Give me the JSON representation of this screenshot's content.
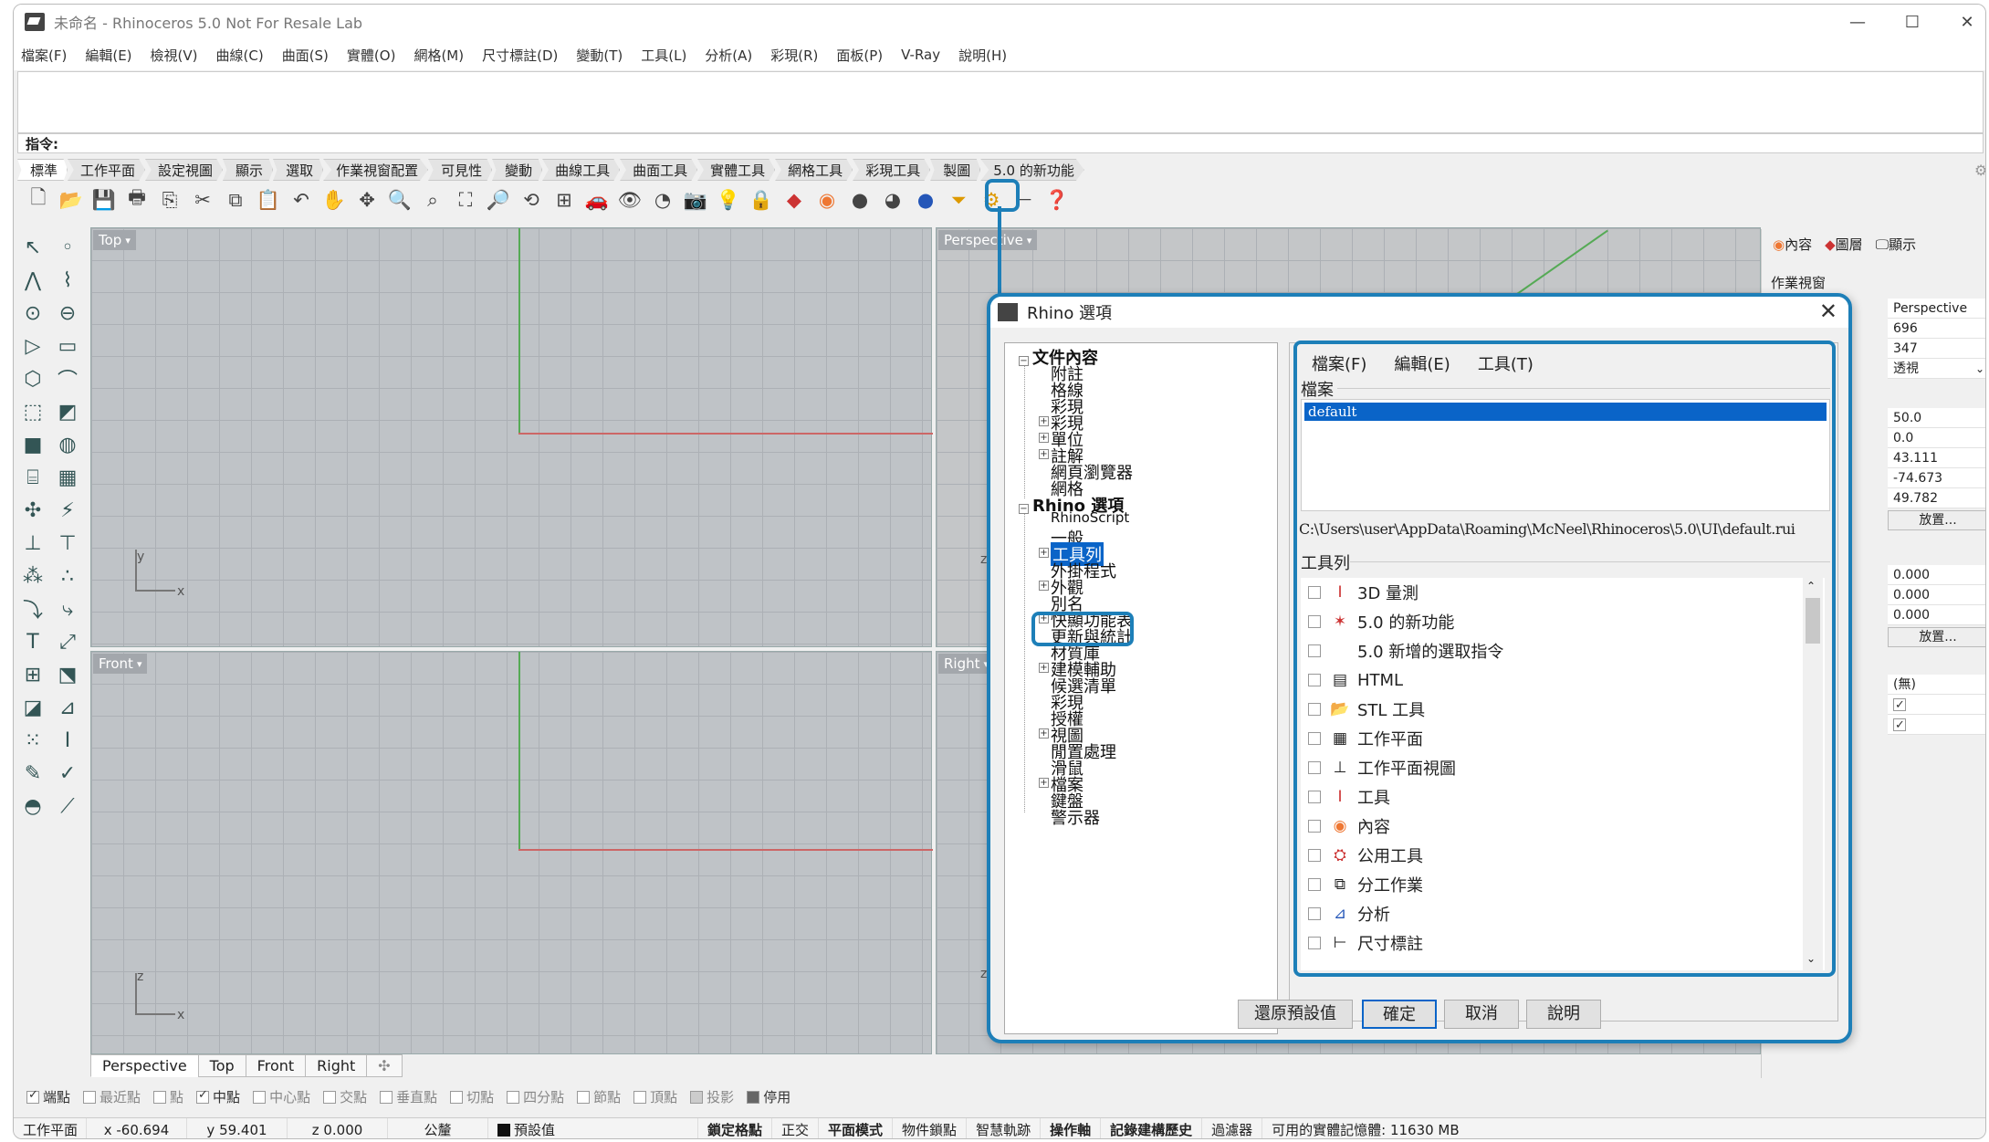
{
  "app": {
    "title": "未命名 - Rhinoceros 5.0 Not For Resale Lab"
  },
  "menu": [
    "檔案(F)",
    "編輯(E)",
    "檢視(V)",
    "曲線(C)",
    "曲面(S)",
    "實體(O)",
    "網格(M)",
    "尺寸標註(D)",
    "變動(T)",
    "工具(L)",
    "分析(A)",
    "彩現(R)",
    "面板(P)",
    "V-Ray",
    "說明(H)"
  ],
  "command": {
    "prompt": "指令:"
  },
  "tabs": [
    "標準",
    "工作平面",
    "設定視圖",
    "顯示",
    "選取",
    "作業視窗配置",
    "可見性",
    "變動",
    "曲線工具",
    "曲面工具",
    "實體工具",
    "網格工具",
    "彩現工具",
    "製圖",
    "5.0 的新功能"
  ],
  "toolbar_icons": [
    "new-icon",
    "open-icon",
    "save-icon",
    "print-icon",
    "export-icon",
    "cut-icon",
    "copy-icon",
    "paste-icon",
    "undo-icon",
    "pan-icon",
    "move-icon",
    "zoom-icon",
    "zoom-window-icon",
    "zoom-extents-icon",
    "zoom-selected-icon",
    "rotate-view-icon",
    "viewport-layout-icon",
    "car-icon",
    "hide-icon",
    "show-icon",
    "snapshot-icon",
    "light-icon",
    "lock-icon",
    "layer-icon",
    "color-wheel-icon",
    "sphere-icon",
    "render-icon",
    "blue-sphere-icon",
    "filter-icon",
    "gear-icon",
    "dimension-icon",
    "help-icon"
  ],
  "viewports": {
    "top": "Top",
    "perspective": "Perspective",
    "front": "Front",
    "right": "Right"
  },
  "axes": {
    "x": "x",
    "y": "y",
    "z": "z"
  },
  "viewport_tabs": [
    "Perspective",
    "Top",
    "Front",
    "Right"
  ],
  "osnap": [
    {
      "label": "端點",
      "on": true
    },
    {
      "label": "最近點",
      "on": false
    },
    {
      "label": "點",
      "on": false
    },
    {
      "label": "中點",
      "on": true
    },
    {
      "label": "中心點",
      "on": false
    },
    {
      "label": "交點",
      "on": false
    },
    {
      "label": "垂直點",
      "on": false
    },
    {
      "label": "切點",
      "on": false
    },
    {
      "label": "四分點",
      "on": false
    },
    {
      "label": "節點",
      "on": false
    },
    {
      "label": "頂點",
      "on": false
    },
    {
      "label": "投影",
      "on": false
    },
    {
      "label": "停用",
      "on": true
    }
  ],
  "status": {
    "plane": "工作平面",
    "x": "x -60.694",
    "y": "y 59.401",
    "z": "z 0.000",
    "unit": "公釐",
    "layer": "預設值",
    "grid": "鎖定格點",
    "ortho": "正交",
    "planar": "平面模式",
    "osnap": "物件鎖點",
    "smarttrack": "智慧軌跡",
    "gumball": "操作軸",
    "history": "記錄建構歷史",
    "filter": "過濾器",
    "memory": "可用的實體記憶體: 11630 MB"
  },
  "props": {
    "tabs": [
      "內容",
      "圖層",
      "顯示"
    ],
    "section": "作業視窗",
    "values": [
      "Perspective",
      "696",
      "347",
      "透視",
      "50.0",
      "0.0",
      "43.111",
      "-74.673",
      "49.782"
    ],
    "place_btn": "放置...",
    "values2": [
      "0.000",
      "0.000",
      "0.000"
    ],
    "none": "(無)"
  },
  "dialog": {
    "title": "Rhino 選項",
    "tree": {
      "doc_root": "文件內容",
      "doc_items": [
        "附註",
        "格線",
        "彩現",
        "彩現",
        "單位",
        "註解",
        "網頁瀏覽器",
        "網格"
      ],
      "opt_root": "Rhino 選項",
      "opt_items": [
        "RhinoScript",
        "一般",
        "工具列",
        "外掛程式",
        "外觀",
        "別名",
        "快顯功能表",
        "更新與統計",
        "材質庫",
        "建模輔助",
        "候選清單",
        "彩現",
        "授權",
        "視圖",
        "閒置處理",
        "滑鼠",
        "檔案",
        "鍵盤",
        "警示器"
      ]
    },
    "menu": [
      "檔案(F)",
      "編輯(E)",
      "工具(T)"
    ],
    "files_label": "檔案",
    "file_selected": "default",
    "path": "C:\\Users\\user\\AppData\\Roaming\\McNeel\\Rhinoceros\\5.0\\UI\\default.rui",
    "toolbars_label": "工具列",
    "toolbars": [
      {
        "label": "3D 量測",
        "icon": "measure-icon"
      },
      {
        "label": "5.0 的新功能",
        "icon": "new-features-icon"
      },
      {
        "label": "5.0 新增的選取指令",
        "icon": ""
      },
      {
        "label": "HTML",
        "icon": "html-icon"
      },
      {
        "label": "STL 工具",
        "icon": "folder-icon"
      },
      {
        "label": "工作平面",
        "icon": "cplane-icon"
      },
      {
        "label": "工作平面視圖",
        "icon": "cplane-view-icon"
      },
      {
        "label": "工具",
        "icon": "tools-icon"
      },
      {
        "label": "內容",
        "icon": "properties-icon"
      },
      {
        "label": "公用工具",
        "icon": "utility-icon"
      },
      {
        "label": "分工作業",
        "icon": "worksession-icon"
      },
      {
        "label": "分析",
        "icon": "analyze-icon"
      },
      {
        "label": "尺寸標註",
        "icon": "dimension-icon"
      }
    ],
    "buttons": {
      "restore": "還原預設值",
      "ok": "確定",
      "cancel": "取消",
      "help": "說明"
    }
  }
}
